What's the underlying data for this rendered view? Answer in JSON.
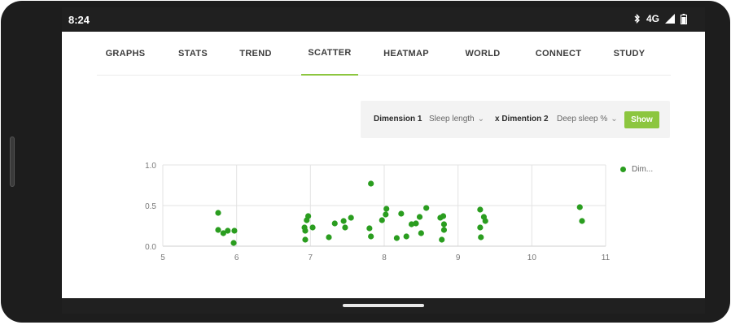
{
  "status_bar": {
    "time": "8:24",
    "network": "4G",
    "icons": [
      "bluetooth-icon",
      "signal-icon",
      "battery-icon"
    ]
  },
  "tabs": [
    {
      "label": "GRAPHS",
      "active": false
    },
    {
      "label": "STATS",
      "active": false
    },
    {
      "label": "TREND",
      "active": false
    },
    {
      "label": "SCATTER",
      "active": true
    },
    {
      "label": "HEATMAP",
      "active": false
    },
    {
      "label": "WORLD",
      "active": false
    },
    {
      "label": "CONNECT",
      "active": false
    },
    {
      "label": "STUDY",
      "active": false
    }
  ],
  "dimensions": {
    "dim1_label": "Dimension 1",
    "dim1_value": "Sleep length",
    "dim2_label": "x Dimention 2",
    "dim2_value": "Deep sleep %",
    "show_label": "Show"
  },
  "colors": {
    "accent": "#8cc63f",
    "point": "#2a9d1f",
    "status_bar": "#202020"
  },
  "chart_data": {
    "type": "scatter",
    "xlim": [
      5,
      11
    ],
    "ylim": [
      0.0,
      1.0
    ],
    "x_ticks": [
      "5",
      "6",
      "7",
      "8",
      "9",
      "10",
      "11"
    ],
    "y_ticks": [
      "0.0",
      "0.5",
      "1.0"
    ],
    "grid": true,
    "legend_label": "Dim...",
    "legend_position": "right",
    "series": [
      {
        "points": [
          [
            5.75,
            0.41
          ],
          [
            5.75,
            0.2
          ],
          [
            5.82,
            0.16
          ],
          [
            5.88,
            0.19
          ],
          [
            5.97,
            0.19
          ],
          [
            5.96,
            0.04
          ],
          [
            6.92,
            0.23
          ],
          [
            6.95,
            0.32
          ],
          [
            6.97,
            0.37
          ],
          [
            6.93,
            0.19
          ],
          [
            6.93,
            0.08
          ],
          [
            7.03,
            0.23
          ],
          [
            7.25,
            0.11
          ],
          [
            7.33,
            0.28
          ],
          [
            7.45,
            0.31
          ],
          [
            7.47,
            0.23
          ],
          [
            7.55,
            0.35
          ],
          [
            7.82,
            0.77
          ],
          [
            7.8,
            0.22
          ],
          [
            7.82,
            0.12
          ],
          [
            7.97,
            0.32
          ],
          [
            8.02,
            0.39
          ],
          [
            8.03,
            0.46
          ],
          [
            8.17,
            0.1
          ],
          [
            8.23,
            0.4
          ],
          [
            8.3,
            0.12
          ],
          [
            8.37,
            0.27
          ],
          [
            8.43,
            0.28
          ],
          [
            8.48,
            0.36
          ],
          [
            8.5,
            0.16
          ],
          [
            8.57,
            0.47
          ],
          [
            8.76,
            0.35
          ],
          [
            8.8,
            0.37
          ],
          [
            8.78,
            0.08
          ],
          [
            8.81,
            0.27
          ],
          [
            8.81,
            0.2
          ],
          [
            9.3,
            0.45
          ],
          [
            9.3,
            0.23
          ],
          [
            9.31,
            0.11
          ],
          [
            9.35,
            0.36
          ],
          [
            9.37,
            0.31
          ],
          [
            10.65,
            0.48
          ],
          [
            10.68,
            0.31
          ]
        ]
      }
    ]
  }
}
